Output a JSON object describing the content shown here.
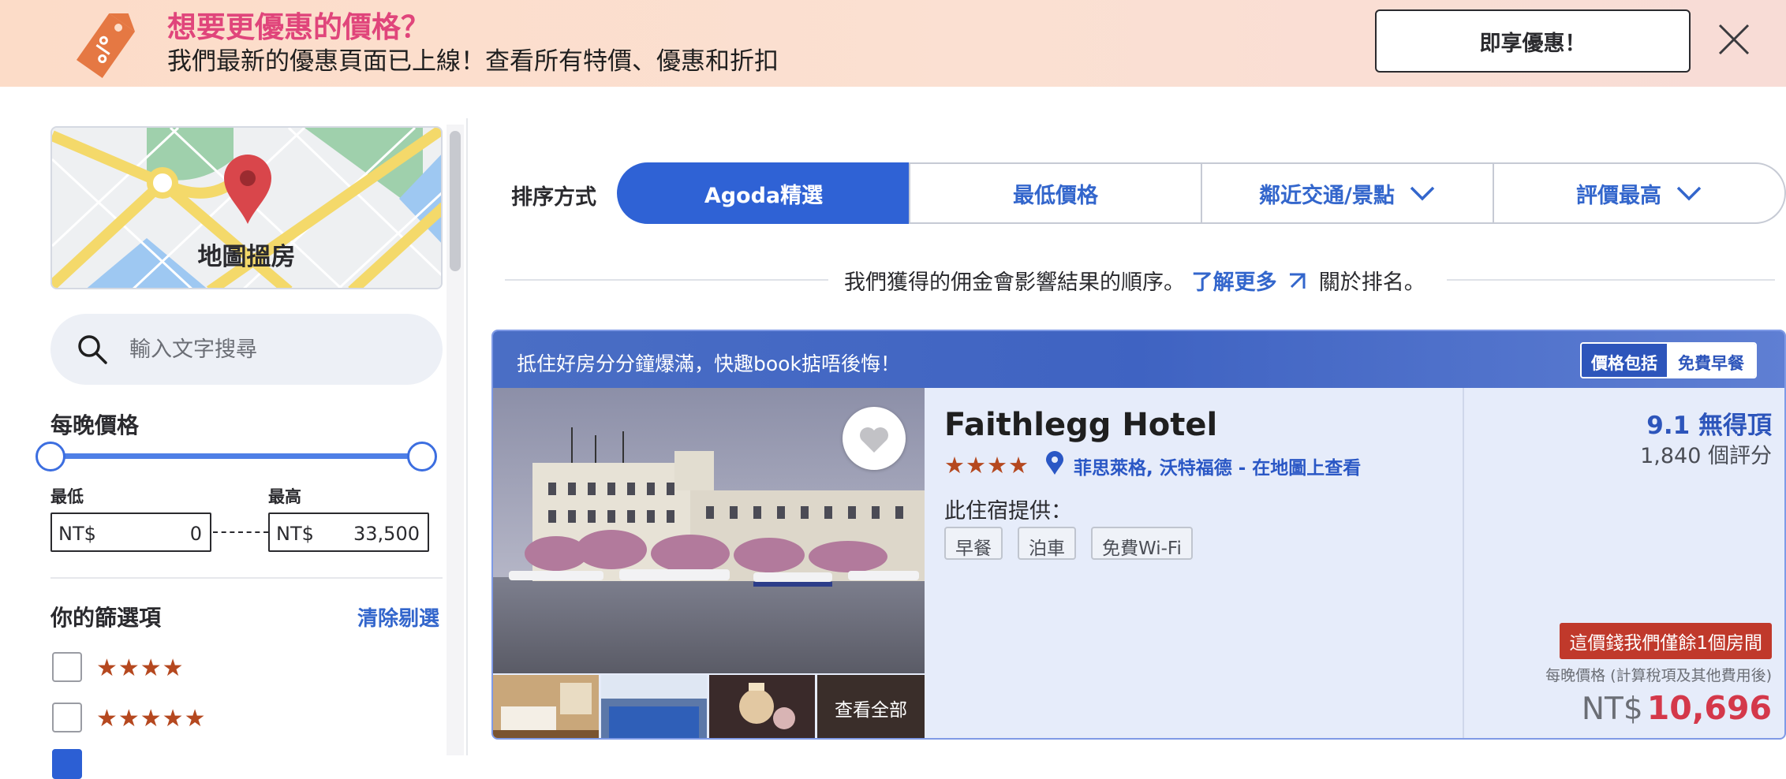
{
  "banner": {
    "title": "想要更優惠的價格？",
    "subtitle": "我們最新的優惠頁面已上線！查看所有特價、優惠和折扣",
    "cta_label": "即享優惠！"
  },
  "sidebar": {
    "map_label": "地圖搵房",
    "search_placeholder": "輸入文字搜尋",
    "price": {
      "heading": "每晚價格",
      "min_label": "最低",
      "max_label": "最高",
      "currency": "NT$",
      "min_value": "0",
      "max_value": "33,500"
    },
    "filters": {
      "heading": "你的篩選項",
      "clear_label": "清除剔選",
      "options": [
        {
          "stars": "★★★★",
          "checked": false
        },
        {
          "stars": "★★★★★",
          "checked": false
        }
      ]
    }
  },
  "sort": {
    "label": "排序方式",
    "tabs": [
      "Agoda精選",
      "最低價格",
      "鄰近交通/景點",
      "評價最高"
    ]
  },
  "notice": {
    "before": "我們獲得的佣金會影響結果的順序。",
    "link": "了解更多",
    "after": "關於排名。"
  },
  "card": {
    "header_text": "抵住好房分分鐘爆滿，快趣book掂唔後悔！",
    "includes_label": "價格包括",
    "includes_value": "免費早餐",
    "see_all": "查看全部",
    "name": "Faithlegg Hotel",
    "stars": "★★★★",
    "location": "菲思萊格, 沃特福德 - 在地圖上查看",
    "amenities_title": "此住宿提供：",
    "amenities": [
      "早餐",
      "泊車",
      "免費Wi-Fi"
    ],
    "score": "9.1 無得頂",
    "reviews": "1,840 個評分",
    "urgency": "這價錢我們僅餘1個房間",
    "per_night_note": "每晚價格 (計算稅項及其他費用後)",
    "currency": "NT$",
    "price": "10,696"
  },
  "colors": {
    "accent": "#2f62d5",
    "link": "#3366cc",
    "price": "#d4384a",
    "stars": "#b5481f",
    "urgency": "#c0392b"
  }
}
